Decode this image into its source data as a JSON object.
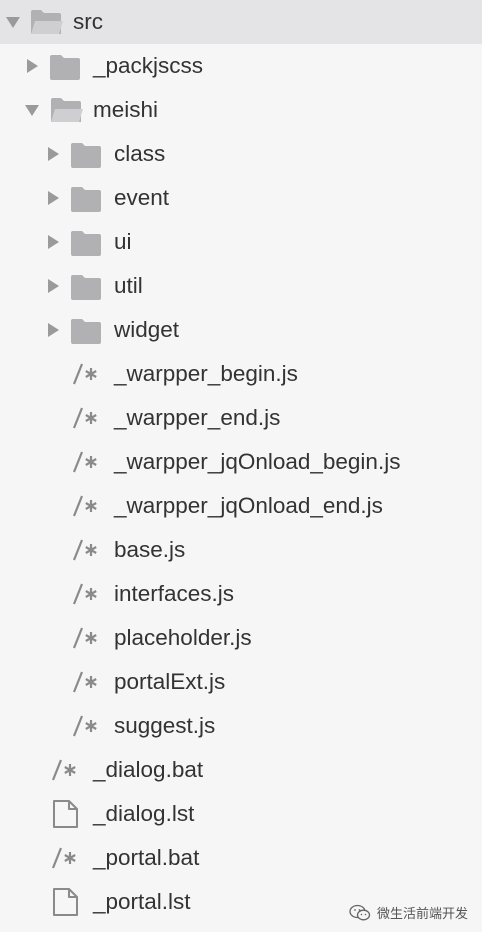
{
  "colors": {
    "background": "#f6f6f6",
    "selected_row": "#e4e4e6",
    "caret": "#9a9a9a",
    "folder": "#b1b1b3",
    "text": "#333333"
  },
  "tree": {
    "src": {
      "label": "src",
      "expanded": true,
      "icon": "folder-open-icon"
    },
    "packjscss": {
      "label": "_packjscss",
      "expanded": false,
      "icon": "folder-icon"
    },
    "meishi": {
      "label": "meishi",
      "expanded": true,
      "icon": "folder-open-icon"
    },
    "class": {
      "label": "class",
      "expanded": false,
      "icon": "folder-icon"
    },
    "event": {
      "label": "event",
      "expanded": false,
      "icon": "folder-icon"
    },
    "ui": {
      "label": "ui",
      "expanded": false,
      "icon": "folder-icon"
    },
    "util": {
      "label": "util",
      "expanded": false,
      "icon": "folder-icon"
    },
    "widget": {
      "label": "widget",
      "expanded": false,
      "icon": "folder-icon"
    },
    "warpper_begin": {
      "label": "_warpper_begin.js",
      "icon": "js-file-icon"
    },
    "warpper_end": {
      "label": "_warpper_end.js",
      "icon": "js-file-icon"
    },
    "warpper_jq_begin": {
      "label": "_warpper_jqOnload_begin.js",
      "icon": "js-file-icon"
    },
    "warpper_jq_end": {
      "label": "_warpper_jqOnload_end.js",
      "icon": "js-file-icon"
    },
    "base": {
      "label": "base.js",
      "icon": "js-file-icon"
    },
    "interfaces": {
      "label": "interfaces.js",
      "icon": "js-file-icon"
    },
    "placeholder": {
      "label": "placeholder.js",
      "icon": "js-file-icon"
    },
    "portalext": {
      "label": "portalExt.js",
      "icon": "js-file-icon"
    },
    "suggest": {
      "label": "suggest.js",
      "icon": "js-file-icon"
    },
    "dialog_bat": {
      "label": "_dialog.bat",
      "icon": "js-file-icon"
    },
    "dialog_lst": {
      "label": "_dialog.lst",
      "icon": "blank-file-icon"
    },
    "portal_bat": {
      "label": "_portal.bat",
      "icon": "js-file-icon"
    },
    "portal_lst": {
      "label": "_portal.lst",
      "icon": "blank-file-icon"
    }
  },
  "watermark": {
    "text": "微生活前端开发",
    "icon": "wechat-logo-icon"
  }
}
